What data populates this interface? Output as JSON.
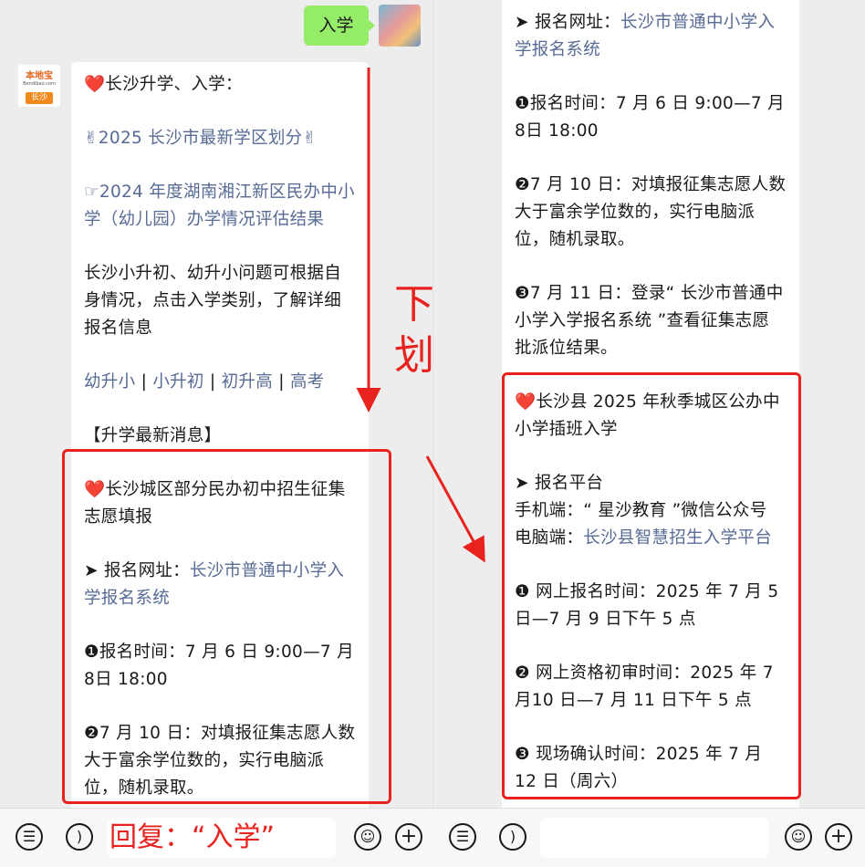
{
  "chat": {
    "sent_message": "入学",
    "official_logo_name": "本地宝",
    "official_logo_url": "Bendibao.com",
    "official_logo_city": "长沙"
  },
  "left_message": {
    "heading": "❤️长沙升学、入学：",
    "link_zoning": "✌2025 长沙市最新学区划分✌",
    "link_evaluation": "☞2024 年度湖南湘江新区民办中小学（幼儿园）办学情况评估结果",
    "intro": "长沙小升初、幼升小问题可根据自身情况，点击入学类别，了解详细报名信息",
    "categories": [
      {
        "label": "幼升小"
      },
      {
        "label": "小升初"
      },
      {
        "label": "初升高"
      },
      {
        "label": "高考"
      }
    ],
    "category_sep": " | ",
    "news_header": "【升学最新消息】",
    "news_title": "❤️长沙城区部分民办初中招生征集志愿填报",
    "reg_site_label": "➤ 报名网址：",
    "reg_site_link": "长沙市普通中小学入学报名系统",
    "reg_time": "❶报名时间：7 月 6 日 9:00—7 月 8日 18:00",
    "lottery": "❷7 月 10 日：对填报征集志愿人数大于富余学位数的，实行电脑派位，随机录取。"
  },
  "right_message": {
    "reg_site_label": "➤ 报名网址：",
    "reg_site_link": "长沙市普通中小学入学报名系统",
    "reg_time": "❶报名时间：7 月 6 日 9:00—7 月 8日 18:00",
    "lottery": "❷7 月 10 日：对填报征集志愿人数大于富余学位数的，实行电脑派位，随机录取。",
    "result_check": "❸7 月 11 日：登录“ 长沙市普通中小学入学报名系统 ”查看征集志愿批派位结果。",
    "county_title": "❤️长沙县 2025 年秋季城区公办中小学插班入学",
    "platform_label": "➤ 报名平台",
    "mobile_line": "手机端：“ 星沙教育 ”微信公众号",
    "pc_label": "电脑端：",
    "pc_link": "长沙县智慧招生入学平台",
    "online_reg": "❶ 网上报名时间：2025 年 7 月 5 日—7 月 9 日下午 5 点",
    "prelim_review": "❷ 网上资格初审时间：2025 年 7 月10 日—7 月 11 日下午 5 点",
    "onsite_confirm": "❸ 现场确认时间：2025 年 7 月 12 日（周六）"
  },
  "annotations": {
    "scroll_hint": "下划",
    "reply_hint": "回复：“入学”",
    "highlight_color": "#e8231f"
  },
  "toolbar": {
    "list_icon": "list-icon",
    "voice_icon": "voice-icon",
    "emoji_icon": "emoji-icon",
    "plus_icon": "plus-icon"
  },
  "colors": {
    "link": "#576b95",
    "sent_bubble": "#95ec69",
    "background": "#ededed"
  }
}
